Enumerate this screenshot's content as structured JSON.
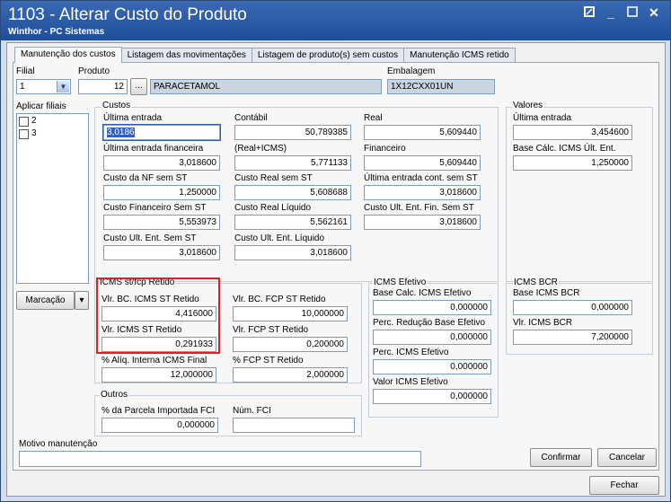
{
  "window": {
    "title": "1103 - Alterar Custo do Produto",
    "subtitle": "Winthor - PC Sistemas",
    "controls": {
      "minimize": "_",
      "close": "✕"
    }
  },
  "tabs": [
    {
      "label": "Manutenção dos custos"
    },
    {
      "label": "Listagem das movimentações"
    },
    {
      "label": "Listagem de produto(s) sem custos"
    },
    {
      "label": "Manutenção ICMS retido"
    }
  ],
  "header": {
    "filial_label": "Filial",
    "filial_value": "1",
    "produto_label": "Produto",
    "produto_code": "12",
    "produto_lookup": "...",
    "produto_name": "PARACETAMOL",
    "embalagem_label": "Embalagem",
    "embalagem_value": "1X12CXX01UN"
  },
  "filiais": {
    "label": "Aplicar filiais",
    "items": [
      "2",
      "3"
    ],
    "marcacao_label": "Marcação",
    "marcacao_arrow": "▾"
  },
  "custos": {
    "title": "Custos",
    "ultima_entrada_label": "Última entrada",
    "ultima_entrada": "3,0186",
    "contabil_label": "Contábil",
    "contabil": "50,789385",
    "real_label": "Real",
    "real": "5,609440",
    "ult_ent_fin_label": "Última entrada financeira",
    "ult_ent_fin": "3,018600",
    "real_icms_label": "(Real+ICMS)",
    "real_icms": "5,771133",
    "financeiro_label": "Financeiro",
    "financeiro": "5,609440",
    "nf_sem_st_label": "Custo da NF sem ST",
    "nf_sem_st": "1,250000",
    "real_sem_st_label": "Custo Real sem ST",
    "real_sem_st": "5,608688",
    "ult_cont_sem_st_label": "Última entrada cont. sem ST",
    "ult_cont_sem_st": "3,018600",
    "fin_sem_st_label": "Custo Financeiro Sem ST",
    "fin_sem_st": "5,553973",
    "real_liquido_label": "Custo Real Líquido",
    "real_liquido": "5,562161",
    "ult_fin_sem_st_label": "Custo Ult. Ent. Fin. Sem ST",
    "ult_fin_sem_st": "3,018600",
    "ult_ent_sem_st_label": "Custo Ult. Ent. Sem ST",
    "ult_ent_sem_st": "3,018600",
    "ult_ent_liquido_label": "Custo Ult. Ent. Líquido",
    "ult_ent_liquido": "3,018600"
  },
  "valores": {
    "title": "Valores",
    "ultima_entrada_label": "Última entrada",
    "ultima_entrada": "3,454600",
    "base_calc_label": "Base Cálc. ICMS Últ. Ent.",
    "base_calc": "1,250000"
  },
  "icms_st": {
    "title": "ICMS st/fcp Retido",
    "vlr_bc_st_label": "Vlr. BC. ICMS ST Retido",
    "vlr_bc_st": "4,416000",
    "vlr_st_label": "Vlr. ICMS ST Retido",
    "vlr_st": "0,291933",
    "aliq_label": "% Alíq. Interna ICMS Final",
    "aliq": "12,000000",
    "vlr_bc_fcp_label": "Vlr. BC. FCP ST Retido",
    "vlr_bc_fcp": "10,000000",
    "vlr_fcp_label": "Vlr. FCP ST Retido",
    "vlr_fcp": "0,200000",
    "pct_fcp_label": "% FCP ST Retido",
    "pct_fcp": "2,000000"
  },
  "icms_efetivo": {
    "title": "ICMS Efetivo",
    "base_label": "Base Calc. ICMS Efetivo",
    "base": "0,000000",
    "perc_red_label": "Perc. Redução Base Efetivo",
    "perc_red": "0,000000",
    "perc_label": "Perc. ICMS Efetivo",
    "perc": "0,000000",
    "valor_label": "Valor ICMS Efetivo",
    "valor": "0,000000"
  },
  "icms_bcr": {
    "title": "ICMS BCR",
    "base_label": "Base ICMS BCR",
    "base": "0,000000",
    "vlr_label": "Vlr. ICMS BCR",
    "vlr": "7,200000"
  },
  "outros": {
    "title": "Outros",
    "parcela_label": "% da Parcela Importada FCI",
    "parcela": "0,000000",
    "num_fci_label": "Núm. FCI",
    "num_fci": ""
  },
  "footer": {
    "motivo_label": "Motivo manutenção",
    "motivo_value": "",
    "confirmar": "Confirmar",
    "cancelar": "Cancelar",
    "fechar": "Fechar"
  },
  "colors": {
    "titlebar": "#1e4e99",
    "highlight_box": "#e02020"
  }
}
